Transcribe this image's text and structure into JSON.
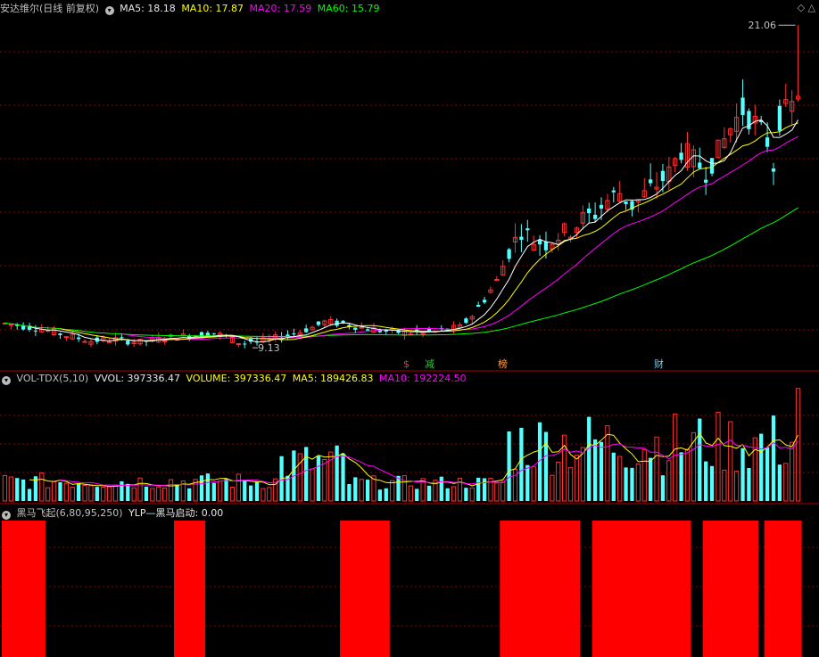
{
  "colors": {
    "up": "#ff3232",
    "down": "#54ffff",
    "ma5": "#ffffff",
    "ma10": "#ffff00",
    "ma20": "#ff00ff",
    "ma60": "#00ff00",
    "grid": "#8b0000",
    "separator": "#b00000",
    "signal": "#ff0000",
    "text": "#c0c0c0"
  },
  "price_header": {
    "title": "安达维尔(日线 前复权)",
    "ma5": "MA5: 18.18",
    "ma10": "MA10: 17.87",
    "ma20": "MA20: 17.59",
    "ma60": "MA60: 15.79"
  },
  "vol_header": {
    "title": "VOL-TDX(5,10)",
    "vvol": "VVOL: 397336.47",
    "volume": "VOLUME: 397336.47",
    "ma5": "MA5: 189426.83",
    "ma10": "MA10: 192224.50"
  },
  "ind_header": {
    "title": "黑马飞起(6,80,95,250)",
    "value": "YLP—黑马启动: 0.00"
  },
  "markers": [
    {
      "text": "$",
      "color": "#ff3232"
    },
    {
      "text": "减",
      "color": "#33cc33"
    },
    {
      "text": "榜",
      "color": "#ffa040"
    },
    {
      "text": "财",
      "color": "#66ccff"
    }
  ],
  "high_label": "21.06",
  "low_label": "9.13",
  "chart_data": {
    "type": "candlestick",
    "high": 21.06,
    "low": 9.13,
    "ohlc": [],
    "volume": [],
    "signal_active": []
  }
}
